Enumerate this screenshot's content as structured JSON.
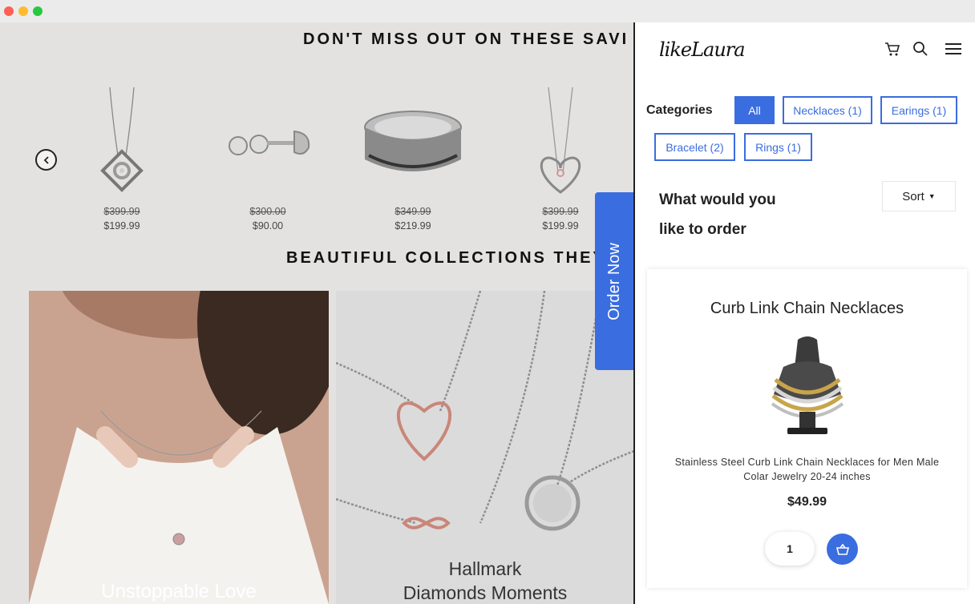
{
  "store": {
    "heading_savings": "DON'T MISS OUT ON THESE SAVI",
    "heading_collections": "BEAUTIFUL COLLECTIONS THEY",
    "products": [
      {
        "old_price": "$399.99",
        "new_price": "$199.99",
        "icon": "love-knot-pendant"
      },
      {
        "old_price": "$300.00",
        "new_price": "$90.00",
        "icon": "stud-earrings"
      },
      {
        "old_price": "$349.99",
        "new_price": "$219.99",
        "icon": "band-ring"
      },
      {
        "old_price": "$399.99",
        "new_price": "$199.99",
        "icon": "heart-pendant"
      }
    ],
    "banners": [
      {
        "caption": "Unstoppable Love"
      },
      {
        "caption_line1": "Hallmark",
        "caption_line2": "Diamonds Moments"
      }
    ]
  },
  "order_now_label": "Order Now",
  "panel": {
    "logo": "likeLaura",
    "categories_label": "Categories",
    "categories": [
      {
        "label": "All",
        "active": true
      },
      {
        "label": "Necklaces (1)"
      },
      {
        "label": "Earings (1)"
      },
      {
        "label": "Bracelet (2)"
      },
      {
        "label": "Rings (1)"
      }
    ],
    "question_line1": "What would you",
    "question_line2": "like to order",
    "sort_label": "Sort",
    "product": {
      "title": "Curb Link Chain Necklaces",
      "description": "Stainless Steel Curb Link Chain Necklaces for Men Male Colar Jewelry 20-24 inches",
      "price": "$49.99",
      "quantity": "1"
    }
  },
  "colors": {
    "accent": "#3a6ddf",
    "background": "#e4e2e1"
  }
}
